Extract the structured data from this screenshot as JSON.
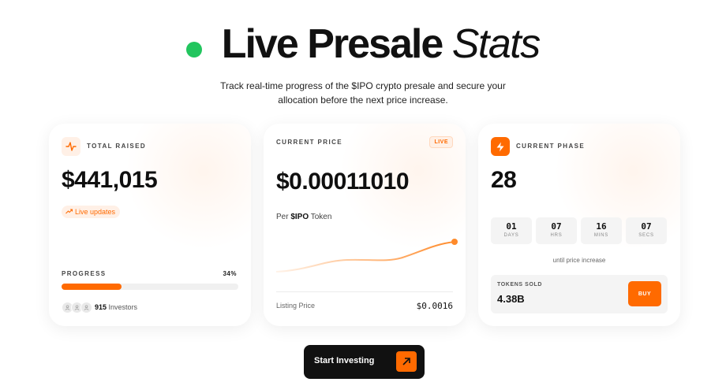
{
  "header": {
    "title_main": "Live Presale",
    "title_accent": "Stats",
    "subtitle": "Track real-time progress of the $IPO crypto presale and secure your allocation before the next price increase."
  },
  "total_raised": {
    "label": "TOTAL RAISED",
    "value": "$441,015",
    "badge": "Live updates",
    "progress_label": "PROGRESS",
    "progress_text": "34%",
    "progress_fraction": 0.34,
    "investors_count": "915",
    "investors_label": "Investors"
  },
  "current_price": {
    "label": "CURRENT PRICE",
    "live_badge": "LIVE",
    "value": "$0.00011010",
    "per_prefix": "Per",
    "token": "$IPO",
    "per_suffix": "Token",
    "listing_label": "Listing Price",
    "listing_value": "$0.0016"
  },
  "current_phase": {
    "label": "CURRENT PHASE",
    "value": "28",
    "countdown": [
      {
        "value": "01",
        "unit": "DAYS"
      },
      {
        "value": "07",
        "unit": "HRS"
      },
      {
        "value": "16",
        "unit": "MINS"
      },
      {
        "value": "07",
        "unit": "SECS"
      }
    ],
    "until_text": "until price increase",
    "tokens_sold_label": "TOKENS SOLD",
    "tokens_sold_value": "4.38B",
    "buy_label": "BUY"
  },
  "cta": {
    "label": "Start Investing"
  },
  "colors": {
    "accent": "#ff6a00",
    "live_dot": "#22c55e",
    "dark": "#111111"
  },
  "icons": [
    "activity-icon",
    "bolt-icon",
    "trend-up-icon",
    "user-icon",
    "arrow-up-right-icon"
  ]
}
